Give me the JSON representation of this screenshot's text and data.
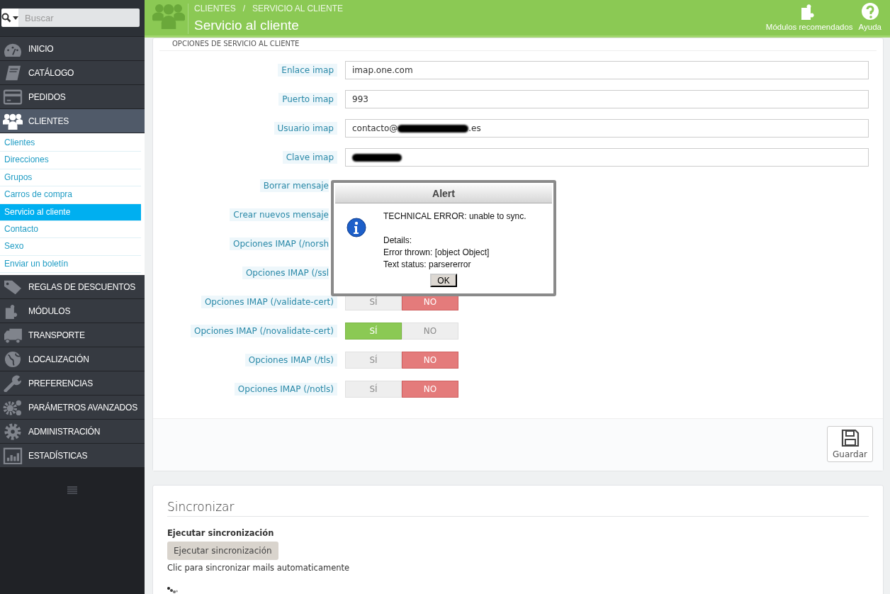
{
  "sidebar": {
    "search": {
      "placeholder": "Buscar"
    },
    "menu": [
      {
        "label": "INICIO",
        "selected": false
      },
      {
        "label": "CATÁLOGO",
        "selected": false
      },
      {
        "label": "PEDIDOS",
        "selected": false
      },
      {
        "label": "CLIENTES",
        "selected": true,
        "children": [
          {
            "label": "Clientes",
            "selected": false
          },
          {
            "label": "Direcciones",
            "selected": false
          },
          {
            "label": "Grupos",
            "selected": false
          },
          {
            "label": "Carros de compra",
            "selected": false
          },
          {
            "label": "Servicio al cliente",
            "selected": true
          },
          {
            "label": "Contacto",
            "selected": false
          },
          {
            "label": "Sexo",
            "selected": false
          },
          {
            "label": "Enviar un boletín",
            "selected": false
          }
        ]
      },
      {
        "label": "REGLAS DE DESCUENTOS",
        "selected": false
      },
      {
        "label": "MÓDULOS",
        "selected": false
      },
      {
        "label": "TRANSPORTE",
        "selected": false
      },
      {
        "label": "LOCALIZACIÓN",
        "selected": false
      },
      {
        "label": "PREFERENCIAS",
        "selected": false
      },
      {
        "label": "PARÁMETROS AVANZADOS",
        "selected": false
      },
      {
        "label": "ADMINISTRACIÓN",
        "selected": false
      },
      {
        "label": "ESTADÍSTICAS",
        "selected": false
      }
    ]
  },
  "header": {
    "breadcrumb": [
      "CLIENTES",
      "SERVICIO AL CLIENTE"
    ],
    "separator": "/",
    "title": "Servicio al cliente",
    "actions": [
      {
        "label": "Módulos recomendados"
      },
      {
        "label": "Ayuda"
      }
    ]
  },
  "options_panel": {
    "heading": "OPCIONES DE SERVICIO AL CLIENTE",
    "rows": [
      {
        "kind": "text",
        "label": "Enlace imap",
        "value": "imap.one.com"
      },
      {
        "kind": "text",
        "label": "Puerto imap",
        "value": "993"
      },
      {
        "kind": "text",
        "label": "Usuario imap",
        "value": "contacto@",
        "value_end": ".es",
        "redacted": true
      },
      {
        "kind": "text",
        "label": "Clave imap",
        "redacted": true
      },
      {
        "kind": "covered",
        "label": "Borrar mensaje"
      },
      {
        "kind": "covered",
        "label": "Crear nuevos mensaje"
      },
      {
        "kind": "covered",
        "label": "Opciones IMAP (/norsh"
      },
      {
        "kind": "covered",
        "label": "Opciones IMAP (/ssl"
      },
      {
        "kind": "switch",
        "label": "Opciones IMAP (/validate-cert)",
        "yes": "SÍ",
        "no": "NO",
        "on": false
      },
      {
        "kind": "switch",
        "label": "Opciones IMAP (/novalidate-cert)",
        "yes": "SÍ",
        "no": "NO",
        "on": true
      },
      {
        "kind": "switch",
        "label": "Opciones IMAP (/tls)",
        "yes": "SÍ",
        "no": "NO",
        "on": false
      },
      {
        "kind": "switch",
        "label": "Opciones IMAP (/notls)",
        "yes": "SÍ",
        "no": "NO",
        "on": false
      }
    ],
    "save_button": "Guardar"
  },
  "sync_panel": {
    "title": "Sincronizar",
    "field_label": "Ejecutar sincronización",
    "button": "Ejecutar sincronización",
    "help": "Clic para sincronizar mails automaticamente"
  },
  "alert": {
    "title": "Alert",
    "message": "TECHNICAL ERROR: unable to sync.",
    "details": [
      "Details:",
      "Error thrown: [object Object]",
      "Text status: parsererror"
    ],
    "button": "OK"
  }
}
